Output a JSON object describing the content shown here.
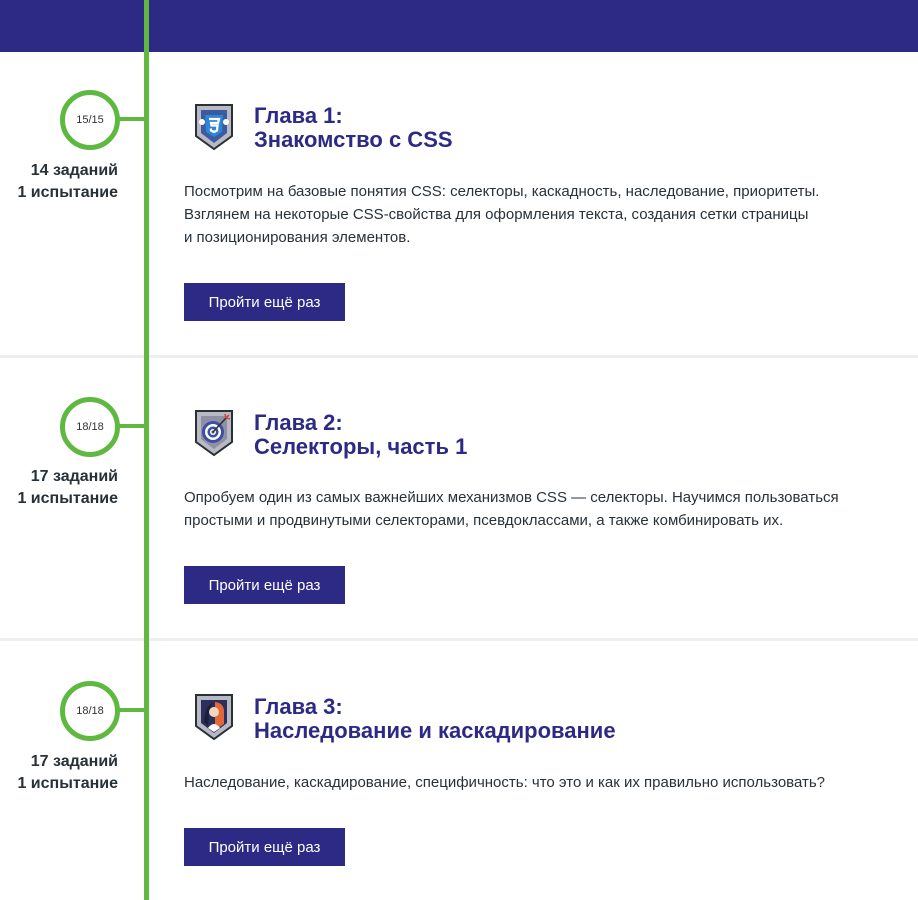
{
  "chapters": [
    {
      "progress": "15/15",
      "tasks": "14 заданий",
      "trials": "1 испытание",
      "chapter_label": "Глава 1:",
      "chapter_name": "Знакомство с CSS",
      "description_lines": [
        "Посмотрим на базовые понятия CSS: селекторы, каскадность, наследование, приоритеты.",
        "Взглянем на некоторые CSS-свойства для оформления текста, создания сетки страницы",
        "и позиционирования элементов."
      ],
      "button_label": "Пройти ещё раз",
      "badge_icon": "css3-shield-icon"
    },
    {
      "progress": "18/18",
      "tasks": "17 заданий",
      "trials": "1 испытание",
      "chapter_label": "Глава 2:",
      "chapter_name": "Селекторы, часть 1",
      "description_lines": [
        "Опробуем один из самых важнейших механизмов CSS — селекторы. Научимся пользоваться",
        "простыми и продвинутыми селекторами, псевдоклассами, а также комбинировать их."
      ],
      "button_label": "Пройти ещё раз",
      "badge_icon": "target-shield-icon"
    },
    {
      "progress": "18/18",
      "tasks": "17 заданий",
      "trials": "1 испытание",
      "chapter_label": "Глава 3:",
      "chapter_name": "Наследование и каскадирование",
      "description_lines": [
        "Наследование, каскадирование, специфичность: что это и как их правильно использовать?"
      ],
      "button_label": "Пройти ещё раз",
      "badge_icon": "portrait-shield-icon"
    }
  ],
  "colors": {
    "brand": "#2d2a85",
    "timeline": "#5fb940",
    "text": "#283138"
  }
}
